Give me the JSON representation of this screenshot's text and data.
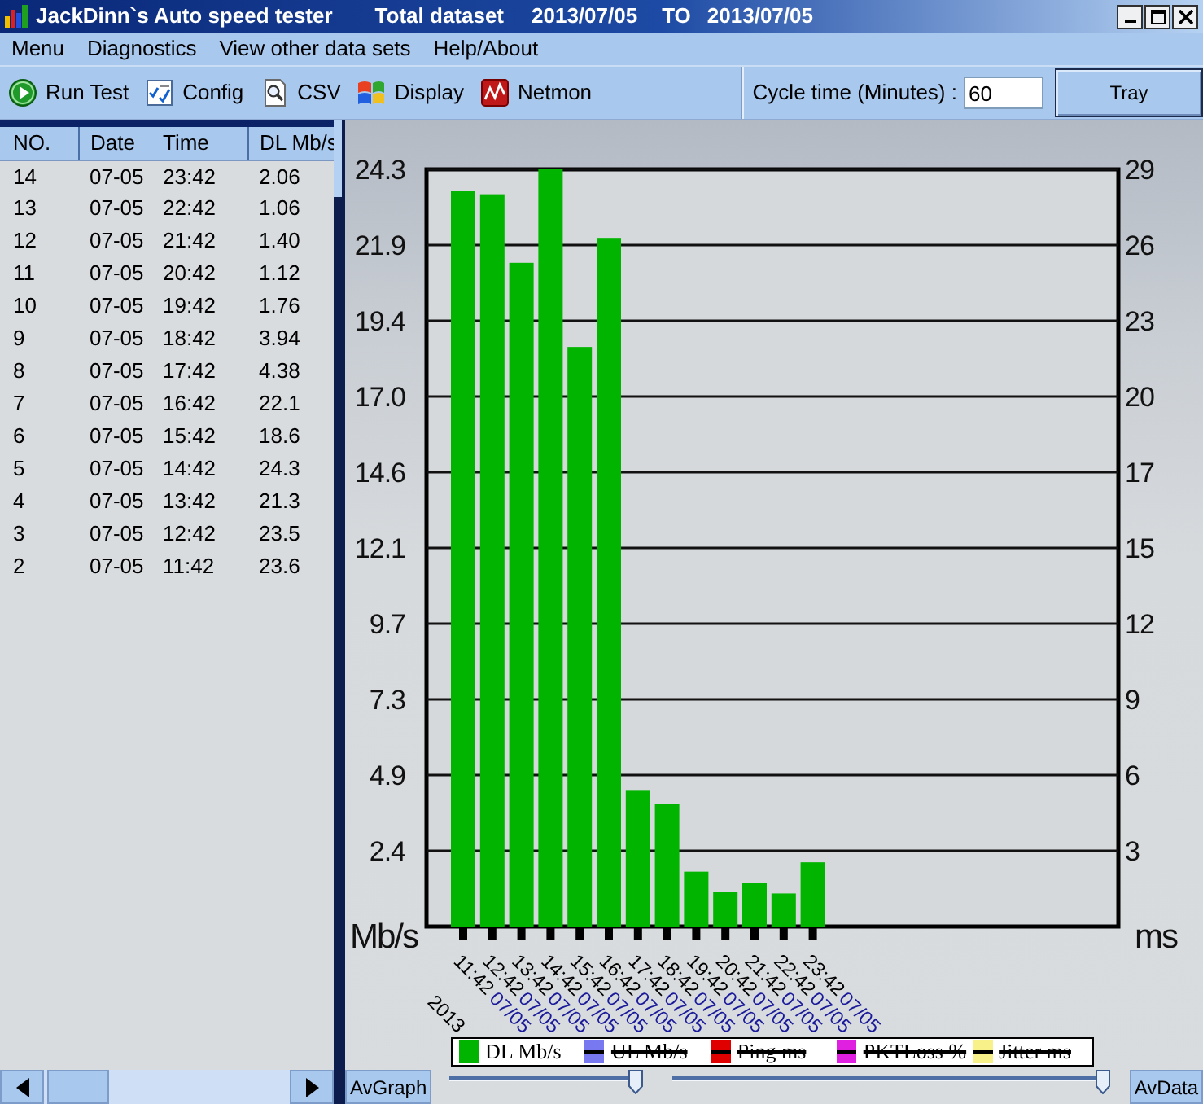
{
  "window": {
    "title": "JackDinn`s Auto speed tester",
    "dataset": "Total dataset",
    "date_from": "2013/07/05",
    "range_word": "TO",
    "date_to": "2013/07/05"
  },
  "menu": [
    {
      "label": "Menu"
    },
    {
      "label": "Diagnostics"
    },
    {
      "label": "View other data sets"
    },
    {
      "label": "Help/About"
    }
  ],
  "toolbar": [
    {
      "label": "Run Test"
    },
    {
      "label": "Config"
    },
    {
      "label": "CSV"
    },
    {
      "label": "Display"
    },
    {
      "label": "Netmon"
    }
  ],
  "cycle_time": {
    "label": "Cycle time (Minutes) :",
    "value": "60"
  },
  "tray_button": {
    "label": "Tray"
  },
  "table": {
    "columns": [
      "NO.",
      "Date",
      "Time",
      "DL Mb/s"
    ],
    "rows": [
      [
        "14",
        "07-05",
        "23:42",
        "2.06"
      ],
      [
        "13",
        "07-05",
        "22:42",
        "1.06"
      ],
      [
        "12",
        "07-05",
        "21:42",
        "1.40"
      ],
      [
        "11",
        "07-05",
        "20:42",
        "1.12"
      ],
      [
        "10",
        "07-05",
        "19:42",
        "1.76"
      ],
      [
        "9",
        "07-05",
        "18:42",
        "3.94"
      ],
      [
        "8",
        "07-05",
        "17:42",
        "4.38"
      ],
      [
        "7",
        "07-05",
        "16:42",
        "22.1"
      ],
      [
        "6",
        "07-05",
        "15:42",
        "18.6"
      ],
      [
        "5",
        "07-05",
        "14:42",
        "24.3"
      ],
      [
        "4",
        "07-05",
        "13:42",
        "21.3"
      ],
      [
        "3",
        "07-05",
        "12:42",
        "23.5"
      ],
      [
        "2",
        "07-05",
        "11:42",
        "23.6"
      ]
    ]
  },
  "chart": {
    "chart_data": {
      "type": "bar",
      "ylabel": "Mb/s",
      "grid": true,
      "categories": [
        "11:42",
        "12:42",
        "13:42",
        "14:42",
        "15:42",
        "16:42",
        "17:42",
        "18:42",
        "19:42",
        "20:42",
        "21:42",
        "22:42",
        "23:42"
      ],
      "series": [
        {
          "name": "DL Mb/s",
          "color": "#00b400",
          "values": [
            23.6,
            23.5,
            21.3,
            24.3,
            18.6,
            22.1,
            4.38,
            3.94,
            1.76,
            1.12,
            1.4,
            1.06,
            2.06
          ]
        },
        {
          "name": "UL Mb/s",
          "color": "#7878f0",
          "values": [
            null,
            null,
            null,
            null,
            null,
            null,
            null,
            null,
            null,
            null,
            null,
            null,
            null
          ]
        },
        {
          "name": "Ping ms",
          "color": "#e00000",
          "values": [
            null,
            null,
            null,
            null,
            null,
            null,
            null,
            null,
            null,
            null,
            null,
            null,
            null
          ]
        },
        {
          "name": "PKTLoss %",
          "color": "#e020e0",
          "values": [
            null,
            null,
            null,
            null,
            null,
            null,
            null,
            null,
            null,
            null,
            null,
            null,
            null
          ]
        },
        {
          "name": "Jitter ms",
          "color": "#f8f088",
          "values": [
            null,
            null,
            null,
            null,
            null,
            null,
            null,
            null,
            null,
            null,
            null,
            null,
            null
          ]
        }
      ],
      "ylim": [
        0,
        24.3
      ],
      "yticks": [
        {
          "value": 2.43,
          "label": "2.4"
        },
        {
          "value": 4.86,
          "label": "4.9"
        },
        {
          "value": 7.29,
          "label": "7.3"
        },
        {
          "value": 9.72,
          "label": "9.7"
        },
        {
          "value": 12.15,
          "label": "12.1"
        },
        {
          "value": 14.58,
          "label": "14.6"
        },
        {
          "value": 17.01,
          "label": "17.0"
        },
        {
          "value": 19.44,
          "label": "19.4"
        },
        {
          "value": 21.87,
          "label": "21.9"
        },
        {
          "value": 24.3,
          "label": "24.3"
        }
      ]
    },
    "right_axis": {
      "label": "ms",
      "ticks": [
        "29",
        "26",
        "23",
        "20",
        "17",
        "15",
        "12",
        "9",
        "6",
        "3"
      ]
    },
    "x_dates": [
      "07/05",
      "07/05",
      "07/05",
      "07/05",
      "07/05",
      "07/05",
      "07/05",
      "07/05",
      "07/05",
      "07/05",
      "07/05",
      "07/05",
      "07/05"
    ],
    "x_year": "2013",
    "legend": [
      {
        "enabled": true
      },
      {
        "enabled": false
      },
      {
        "enabled": false
      },
      {
        "enabled": false
      },
      {
        "enabled": false
      }
    ]
  },
  "bottom": {
    "left_button": "AvGraph",
    "right_button": "AvData",
    "sliders": [
      {
        "level": 1
      },
      {
        "level": 1
      }
    ]
  }
}
